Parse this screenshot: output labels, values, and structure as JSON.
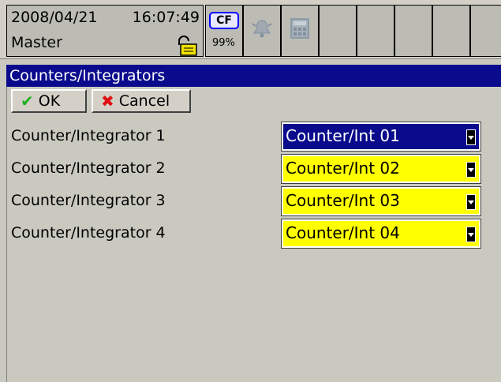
{
  "status": {
    "date": "2008/04/21",
    "time": "16:07:49",
    "user": "Master",
    "cf_label": "CF",
    "cf_percent": "99%"
  },
  "window": {
    "title": "Counters/Integrators"
  },
  "buttons": {
    "ok_label": "OK",
    "cancel_label": "Cancel"
  },
  "rows": [
    {
      "label": "Counter/Integrator 1",
      "value": "Counter/Int 01"
    },
    {
      "label": "Counter/Integrator 2",
      "value": "Counter/Int 02"
    },
    {
      "label": "Counter/Integrator 3",
      "value": "Counter/Int 03"
    },
    {
      "label": "Counter/Integrator 4",
      "value": "Counter/Int 04"
    }
  ],
  "colors": {
    "title_bar": "#0a0a8c",
    "field_highlight": "#ffff00",
    "field_selected": "#0a0a8c",
    "background": "#c9c9c0"
  },
  "icons": [
    "lock-icon",
    "alarm-bell-icon",
    "calculator-icon",
    "ok-check-icon",
    "cancel-x-icon",
    "dropdown-arrow-icon"
  ]
}
